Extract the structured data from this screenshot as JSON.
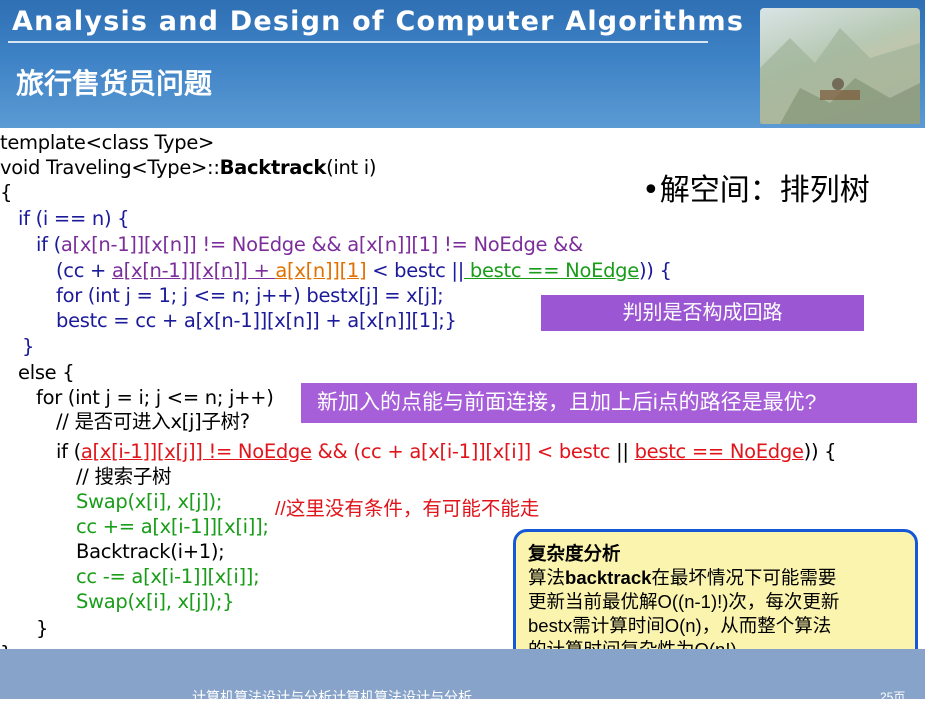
{
  "header": {
    "title": "Analysis and Design of Computer Algorithms",
    "subtitle": "旅行售货员问题"
  },
  "code": {
    "line1": "template<class Type>",
    "line2a": "void Traveling<Type>::",
    "line2b": "Backtrack",
    "line2c": "(int i)",
    "line3": "{",
    "line4": "if (i == n) {",
    "line5a": "if (",
    "line5b": "a[x[n-1]][x[n]] != NoEdge && a[x[n]][1] != NoEdge &&",
    "line6a": "(cc + ",
    "line6b": "a[x[n-1]][x[n]] + ",
    "line6c": "a[x[n]][1]",
    "line6d": " < bestc ||",
    "line6e": " bestc == NoEdge",
    "line6f": ")) {",
    "line7": "for (int j = 1; j <= n; j++) bestx[j] = x[j];",
    "line8": "bestc = cc + a[x[n-1]][x[n]] + a[x[n]][1];}",
    "line9": "}",
    "line10": "else {",
    "line11": "for (int j = i; j <= n; j++)",
    "line12": "// 是否可进入x[j]子树?",
    "line13a": "if (",
    "line13b": "a[x[i-1]][x[j]] != NoEdge",
    "line13c": " && (cc + a[x[i-1]][x[i]] < bestc",
    "line13d": " || ",
    "line13e": "bestc == NoEdge",
    "line13f": ")) {",
    "line14": "// 搜索子树",
    "line15": "Swap(x[i], x[j]);",
    "line16": "cc += a[x[i-1]][x[i]];",
    "line17": "Backtrack(i+1);",
    "line18": "cc -= a[x[i-1]][x[i]];",
    "line19": "Swap(x[i], x[j]);}",
    "line20": "}",
    "line21": "}"
  },
  "annotations": {
    "solution_space": "•解空间：排列树",
    "loop_check": "判别是否构成回路",
    "new_point": "新加入的点能与前面连接，且加上后i点的路径是最优?",
    "no_condition": "//这里没有条件，有可能不能走"
  },
  "complexity": {
    "title": "复杂度分析",
    "line1a": "算法",
    "line1b": "backtrack",
    "line1c": "在最坏情况下可能需要",
    "line2": "更新当前最优解O((n-1)!)次，每次更新",
    "line3": "bestx需计算时间O(n)，从而整个算法",
    "line4": "的计算时间复杂性为O(n!)。"
  },
  "footer": {
    "text": "计算机算法设计与分析计算机算法设计与分析",
    "page": "25页"
  }
}
